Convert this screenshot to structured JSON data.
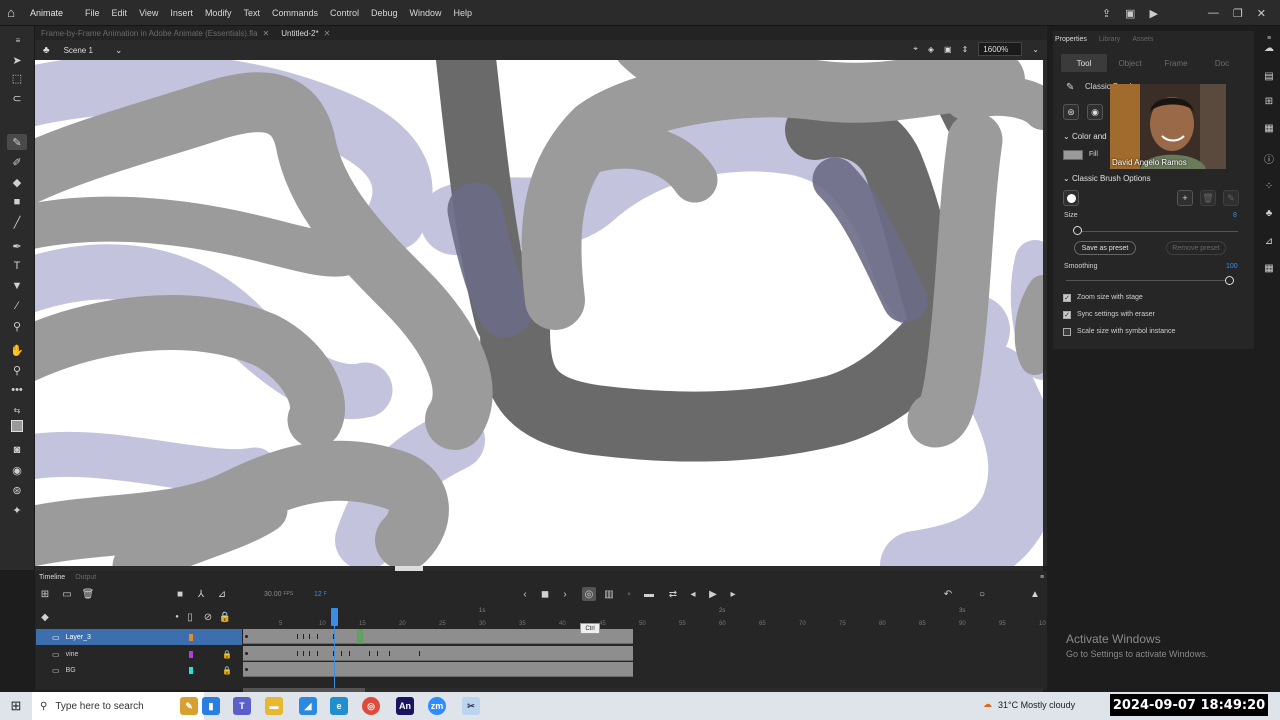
{
  "menubar": {
    "app_name": "Animate",
    "items": [
      "File",
      "Edit",
      "View",
      "Insert",
      "Modify",
      "Text",
      "Commands",
      "Control",
      "Debug",
      "Window",
      "Help"
    ]
  },
  "doc_tabs": [
    {
      "label": "Frame-by-Frame Animation in Adobe Animate (Essentials).fla",
      "active": false
    },
    {
      "label": "Untitled-2*",
      "active": true
    }
  ],
  "scene": {
    "label": "Scene 1",
    "zoom": "1600%"
  },
  "properties": {
    "tabs": [
      "Properties",
      "Library",
      "Assets"
    ],
    "subtabs": [
      "Tool",
      "Object",
      "Frame",
      "Doc"
    ],
    "tool_name": "Classic Brush",
    "color_section": "Color and",
    "fill_label": "Fill",
    "brush_section": "Classic Brush Options",
    "size_label": "Size",
    "size_value": "8",
    "save_preset": "Save as preset",
    "remove_preset": "Remove preset",
    "smoothing_label": "Smoothing",
    "smoothing_value": "100",
    "checks": [
      {
        "label": "Zoom size with stage",
        "checked": true
      },
      {
        "label": "Sync settings with eraser",
        "checked": true
      },
      {
        "label": "Scale size with symbol instance",
        "checked": false
      }
    ]
  },
  "webcam": {
    "name": "David Angelo Ramos"
  },
  "timeline": {
    "tabs": [
      "Timeline",
      "Output"
    ],
    "fps": "30.00",
    "fps_unit": "FPS",
    "current_frame": "12",
    "frame_unit": "F",
    "tooltip": "Ctrl",
    "ruler_numbers": [
      "5",
      "10",
      "15",
      "20",
      "25",
      "30",
      "35",
      "40",
      "45",
      "50",
      "55",
      "60",
      "65",
      "70",
      "75",
      "80",
      "85",
      "90",
      "95",
      "10"
    ],
    "ruler_seconds": [
      "1s",
      "2s",
      "3s"
    ],
    "layers": [
      {
        "name": "Layer_3",
        "color": "#e58a2a",
        "selected": true,
        "locked": false
      },
      {
        "name": "vine",
        "color": "#b040d8",
        "selected": false,
        "locked": true
      },
      {
        "name": "BG",
        "color": "#2ee0d8",
        "selected": false,
        "locked": true
      }
    ]
  },
  "watermark": {
    "title": "Activate Windows",
    "subtitle": "Go to Settings to activate Windows."
  },
  "taskbar": {
    "search_placeholder": "Type here to search",
    "weather": "31°C  Mostly cloudy",
    "datetime": "2024-09-07  18:49:20"
  }
}
